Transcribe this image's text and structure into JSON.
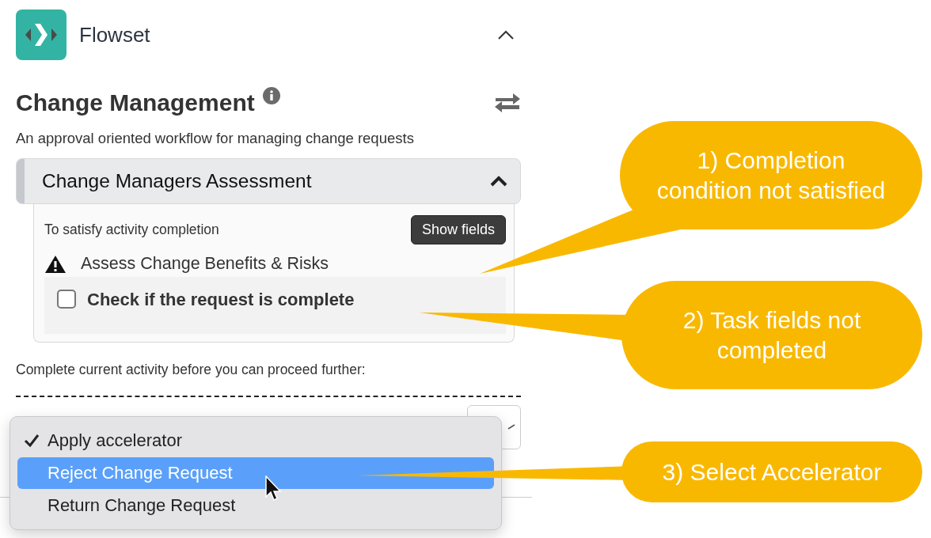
{
  "app": {
    "name": "Flowset",
    "expanded": true
  },
  "workflow": {
    "title": "Change Management",
    "description": "An approval oriented workflow for managing change requests"
  },
  "activity": {
    "title": "Change Managers Assessment",
    "expanded": true,
    "prompt": "To satisfy activity completion",
    "show_fields_button": "Show fields",
    "tasks": [
      {
        "title": "Assess Change Benefits & Risks",
        "warning": true,
        "fields": [
          {
            "label": "Check if the request is complete",
            "checked": false
          }
        ]
      }
    ]
  },
  "proceed_note": "Complete current activity before you can proceed further:",
  "accelerator_menu": [
    {
      "label": "Apply accelerator",
      "checked": true,
      "highlighted": false
    },
    {
      "label": "Reject Change Request",
      "checked": false,
      "highlighted": true
    },
    {
      "label": "Return Change Request",
      "checked": false,
      "highlighted": false
    }
  ],
  "callouts": [
    {
      "lines": [
        "1) Completion",
        "condition not satisfied"
      ]
    },
    {
      "lines": [
        "2) Task fields not",
        "completed"
      ]
    },
    {
      "lines": [
        "3) Select Accelerator"
      ]
    }
  ]
}
